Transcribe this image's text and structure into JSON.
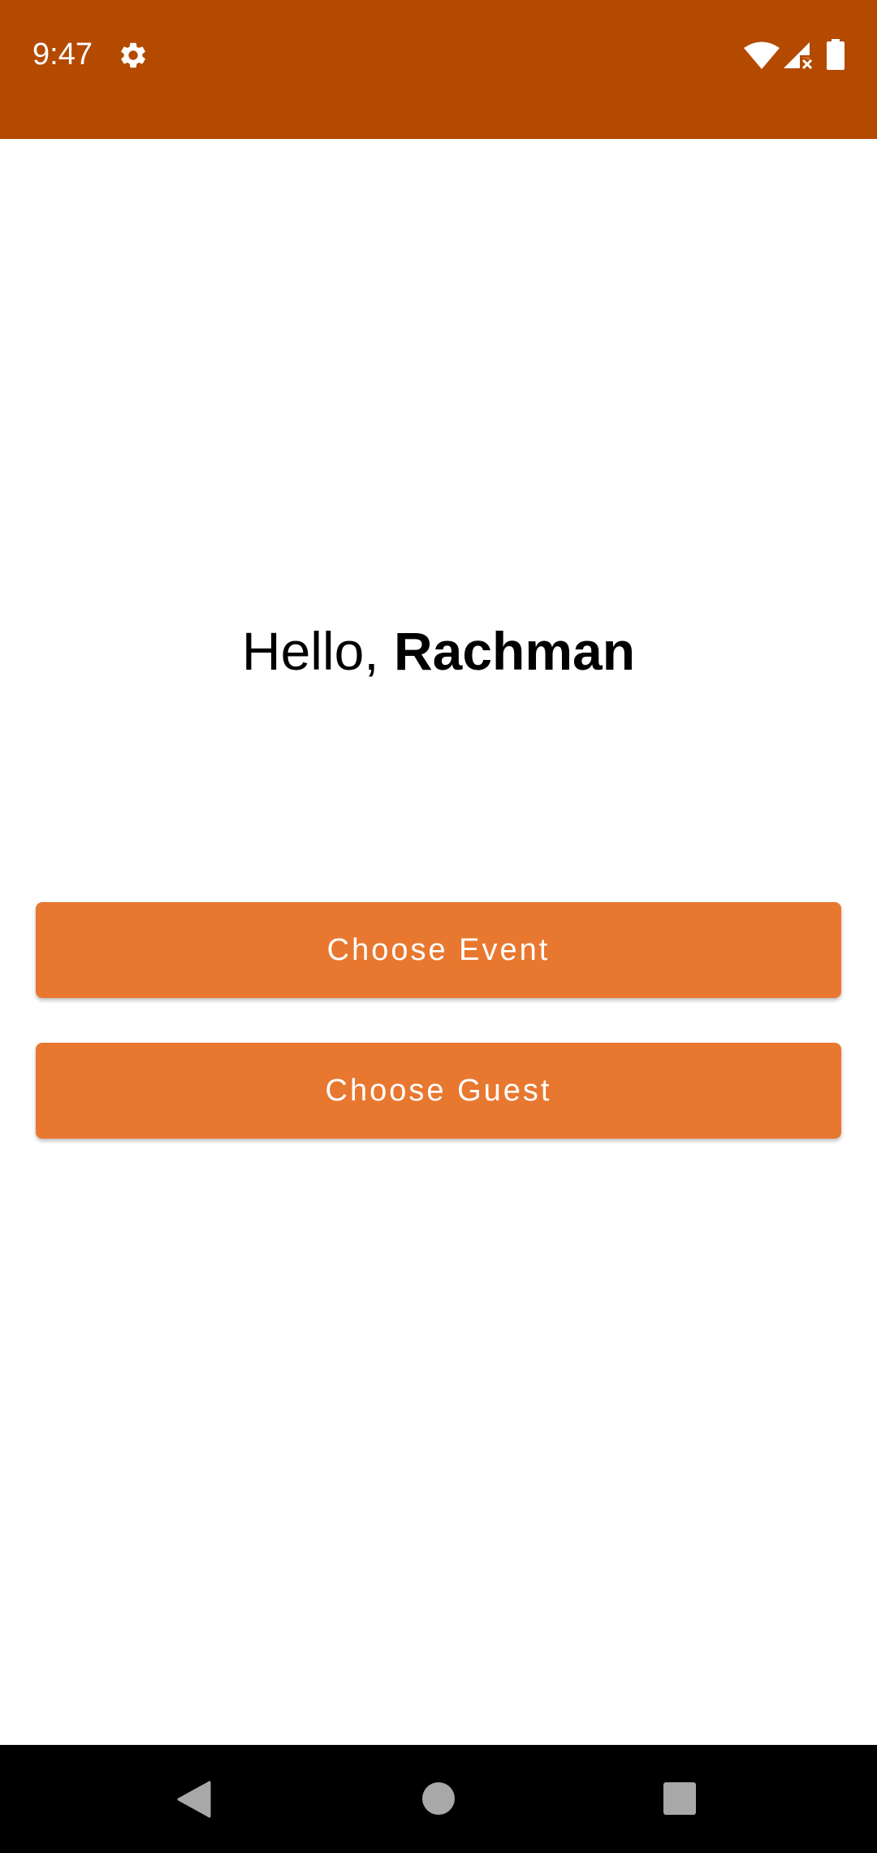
{
  "status_bar": {
    "time": "9:47",
    "background_color": "#B34A00",
    "icons": [
      "gear-icon",
      "wifi-icon",
      "cell-signal-no-service-icon",
      "battery-icon"
    ]
  },
  "greeting": {
    "prefix": "Hello, ",
    "name": "Rachman"
  },
  "buttons": {
    "choose_event": "Choose Event",
    "choose_guest": "Choose Guest",
    "color": "#E87830"
  },
  "nav_bar": {
    "icons": [
      "back-icon",
      "home-icon",
      "recents-icon"
    ]
  }
}
